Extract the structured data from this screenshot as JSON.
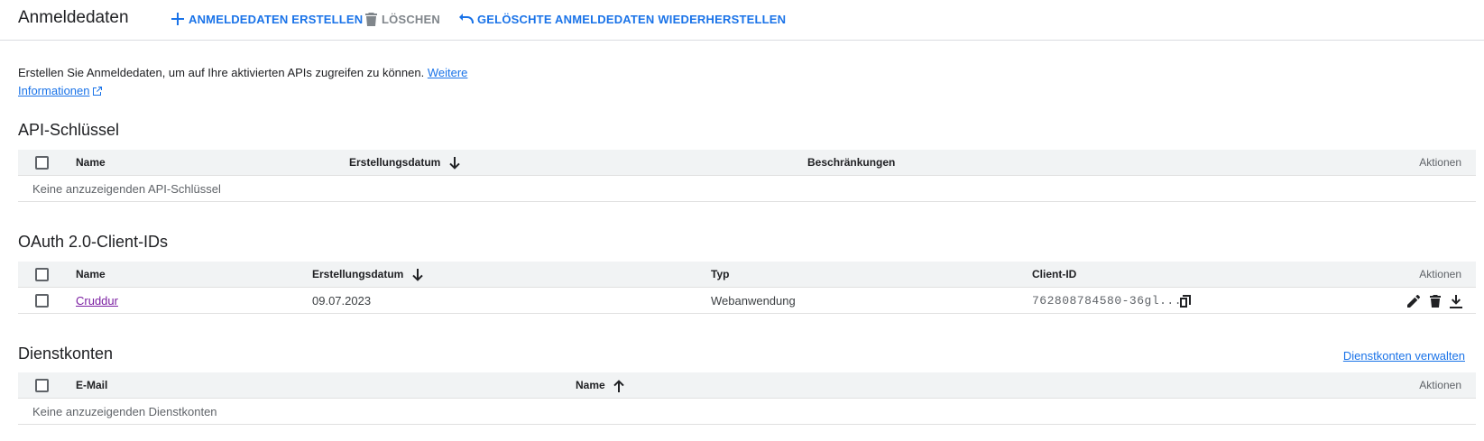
{
  "header": {
    "title": "Anmeldedaten",
    "create_label": "ANMELDEDATEN ERSTELLEN",
    "delete_label": "LÖSCHEN",
    "restore_label": "GELÖSCHTE ANMELDEDATEN WIEDERHERSTELLEN"
  },
  "intro": {
    "text": "Erstellen Sie Anmeldedaten, um auf Ihre aktivierten APIs zugreifen zu können.",
    "link_part1": "Weitere",
    "link_part2": "Informationen"
  },
  "api_keys": {
    "title": "API-Schlüssel",
    "columns": {
      "name": "Name",
      "created": "Erstellungsdatum",
      "restrictions": "Beschränkungen",
      "actions": "Aktionen"
    },
    "empty_text": "Keine anzuzeigenden API-Schlüssel"
  },
  "oauth": {
    "title": "OAuth 2.0-Client-IDs",
    "columns": {
      "name": "Name",
      "created": "Erstellungsdatum",
      "type": "Typ",
      "client_id": "Client-ID",
      "actions": "Aktionen"
    },
    "rows": [
      {
        "name": "Cruddur",
        "created": "09.07.2023",
        "type": "Webanwendung",
        "client_id": "762808784580-36gl..."
      }
    ]
  },
  "service_accounts": {
    "title": "Dienstkonten",
    "manage_label": "Dienstkonten verwalten",
    "columns": {
      "email": "E-Mail",
      "name": "Name",
      "actions": "Aktionen"
    },
    "empty_text": "Keine anzuzeigenden Dienstkonten"
  },
  "icons": {
    "create": "plus-icon",
    "delete": "trash-icon",
    "restore": "undo-icon",
    "external": "external-link-icon",
    "sort_down": "arrow-down-icon",
    "sort_up": "arrow-up-icon",
    "copy": "copy-icon",
    "edit": "pencil-icon",
    "download": "download-icon"
  },
  "colors": {
    "accent": "#1a73e8",
    "visited_link": "#7b1fa2",
    "header_bg": "#f1f3f4",
    "disabled": "#80868b"
  }
}
